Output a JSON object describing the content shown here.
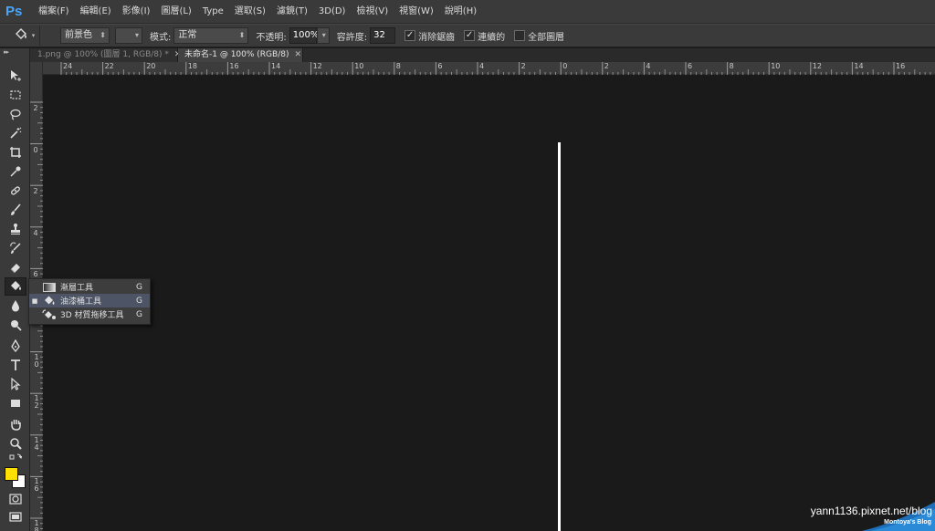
{
  "app": {
    "logo": "Ps"
  },
  "menu": [
    "檔案(F)",
    "編輯(E)",
    "影像(I)",
    "圖層(L)",
    "Type",
    "選取(S)",
    "濾鏡(T)",
    "3D(D)",
    "檢視(V)",
    "視窗(W)",
    "說明(H)"
  ],
  "options": {
    "fill_source": "前景色",
    "pattern": "",
    "mode_label": "模式:",
    "mode_value": "正常",
    "opacity_label": "不透明:",
    "opacity_value": "100%",
    "tolerance_label": "容許度:",
    "tolerance_value": "32",
    "anti_alias_label": "消除鋸齒",
    "anti_alias_checked": true,
    "contiguous_label": "連續的",
    "contiguous_checked": true,
    "all_layers_label": "全部圖層",
    "all_layers_checked": false
  },
  "tabs": [
    {
      "label": "1.png @ 100% (圖層 1, RGB/8) *",
      "active": false
    },
    {
      "label": "未命名-1 @ 100% (RGB/8)",
      "active": true
    }
  ],
  "ruler_top": [
    "24",
    "22",
    "20",
    "18",
    "16",
    "14",
    "12",
    "10",
    "8",
    "6",
    "4",
    "2",
    "0",
    "2",
    "4",
    "6",
    "8",
    "10",
    "12",
    "14",
    "16"
  ],
  "ruler_left": [
    "2",
    "0",
    "2",
    "4",
    "6",
    "8",
    "10",
    "12",
    "14",
    "16",
    "18"
  ],
  "flyout": [
    {
      "label": "漸層工具",
      "shortcut": "G",
      "icon": "gradient-icon",
      "current": false
    },
    {
      "label": "油漆桶工具",
      "shortcut": "G",
      "icon": "paint-bucket-icon",
      "current": true
    },
    {
      "label": "3D 材質拖移工具",
      "shortcut": "G",
      "icon": "3d-material-drop-icon",
      "current": false
    }
  ],
  "colors": {
    "foreground": "#ffe000",
    "background": "#ffffff",
    "accent": "#49a6ff"
  },
  "watermark": {
    "url": "yann1136.pixnet.net/blog",
    "subtitle": "Montoya's  Blog"
  }
}
